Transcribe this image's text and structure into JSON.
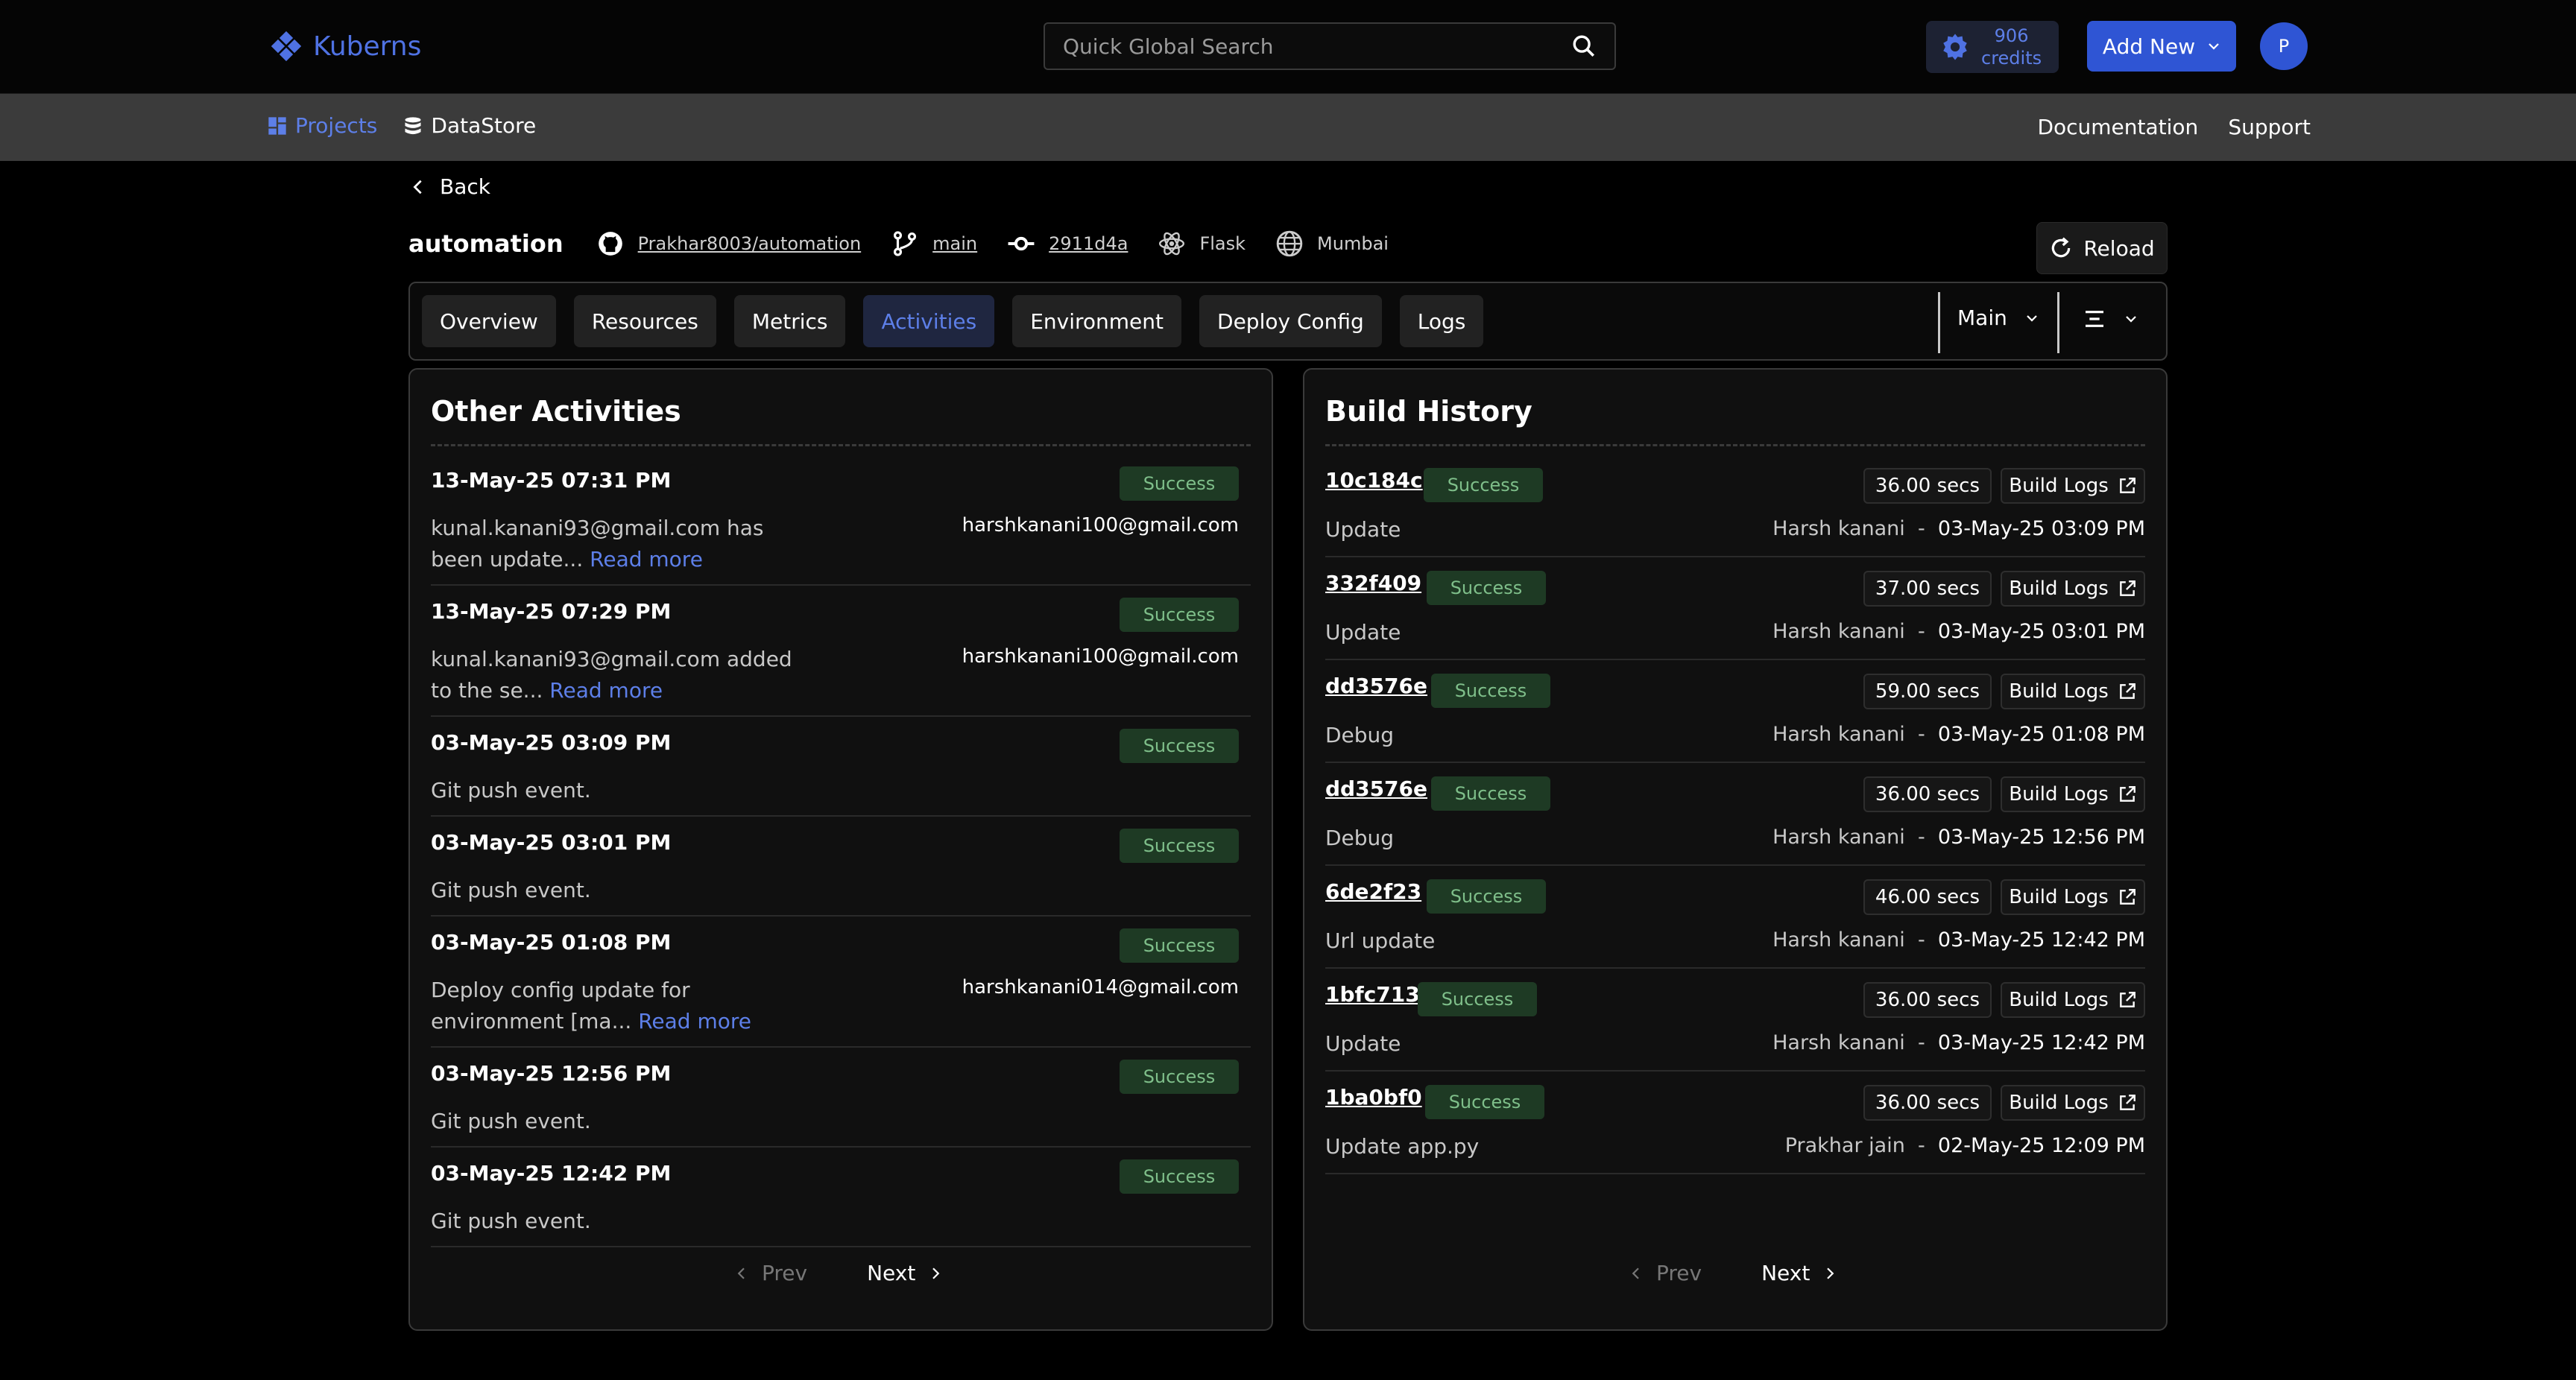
{
  "app": {
    "name": "Kuberns"
  },
  "search": {
    "placeholder": "Quick Global Search"
  },
  "credits": {
    "amount": "906",
    "label": "credits"
  },
  "add_new": {
    "label": "Add New"
  },
  "avatar": {
    "initial": "P"
  },
  "nav": {
    "projects": "Projects",
    "datastore": "DataStore",
    "documentation": "Documentation",
    "support": "Support"
  },
  "back": {
    "label": "Back"
  },
  "project": {
    "name": "automation",
    "repo": "Prakhar8003/automation",
    "branch": "main",
    "commit": "2911d4a",
    "framework": "Flask",
    "region": "Mumbai"
  },
  "reload": {
    "label": "Reload"
  },
  "tabs": [
    "Overview",
    "Resources",
    "Metrics",
    "Activities",
    "Environment",
    "Deploy Config",
    "Logs"
  ],
  "active_tab": "Activities",
  "branch_select": {
    "value": "Main"
  },
  "activities": {
    "title": "Other Activities",
    "items": [
      {
        "date": "13-May-25 07:31 PM",
        "status": "Success",
        "desc": "kunal.kanani93@gmail.com has been update...",
        "more": "Read more",
        "email": "harshkanani100@gmail.com"
      },
      {
        "date": "13-May-25 07:29 PM",
        "status": "Success",
        "desc": "kunal.kanani93@gmail.com added to the se...",
        "more": "Read more",
        "email": "harshkanani100@gmail.com"
      },
      {
        "date": "03-May-25 03:09 PM",
        "status": "Success",
        "desc": "Git push event.",
        "more": "",
        "email": ""
      },
      {
        "date": "03-May-25 03:01 PM",
        "status": "Success",
        "desc": "Git push event.",
        "more": "",
        "email": ""
      },
      {
        "date": "03-May-25 01:08 PM",
        "status": "Success",
        "desc": "Deploy config update for environment [ma...",
        "more": "Read more",
        "email": "harshkanani014@gmail.com"
      },
      {
        "date": "03-May-25 12:56 PM",
        "status": "Success",
        "desc": "Git push event.",
        "more": "",
        "email": ""
      },
      {
        "date": "03-May-25 12:42 PM",
        "status": "Success",
        "desc": "Git push event.",
        "more": "",
        "email": ""
      }
    ],
    "prev": "Prev",
    "next": "Next"
  },
  "builds": {
    "title": "Build History",
    "logs_label": "Build Logs",
    "items": [
      {
        "commit": "10c184c",
        "status": "Success",
        "duration": "36.00 secs",
        "message": "Update",
        "author": "Harsh kanani",
        "time": "03-May-25 03:09 PM"
      },
      {
        "commit": "332f409",
        "status": "Success",
        "duration": "37.00 secs",
        "message": "Update",
        "author": "Harsh kanani",
        "time": "03-May-25 03:01 PM"
      },
      {
        "commit": "dd3576e",
        "status": "Success",
        "duration": "59.00 secs",
        "message": "Debug",
        "author": "Harsh kanani",
        "time": "03-May-25 01:08 PM"
      },
      {
        "commit": "dd3576e",
        "status": "Success",
        "duration": "36.00 secs",
        "message": "Debug",
        "author": "Harsh kanani",
        "time": "03-May-25 12:56 PM"
      },
      {
        "commit": "6de2f23",
        "status": "Success",
        "duration": "46.00 secs",
        "message": "Url update",
        "author": "Harsh kanani",
        "time": "03-May-25 12:42 PM"
      },
      {
        "commit": "1bfc713",
        "status": "Success",
        "duration": "36.00 secs",
        "message": "Update",
        "author": "Harsh kanani",
        "time": "03-May-25 12:42 PM"
      },
      {
        "commit": "1ba0bf0",
        "status": "Success",
        "duration": "36.00 secs",
        "message": "Update app.py",
        "author": "Prakhar jain",
        "time": "02-May-25 12:09 PM"
      }
    ],
    "prev": "Prev",
    "next": "Next"
  }
}
